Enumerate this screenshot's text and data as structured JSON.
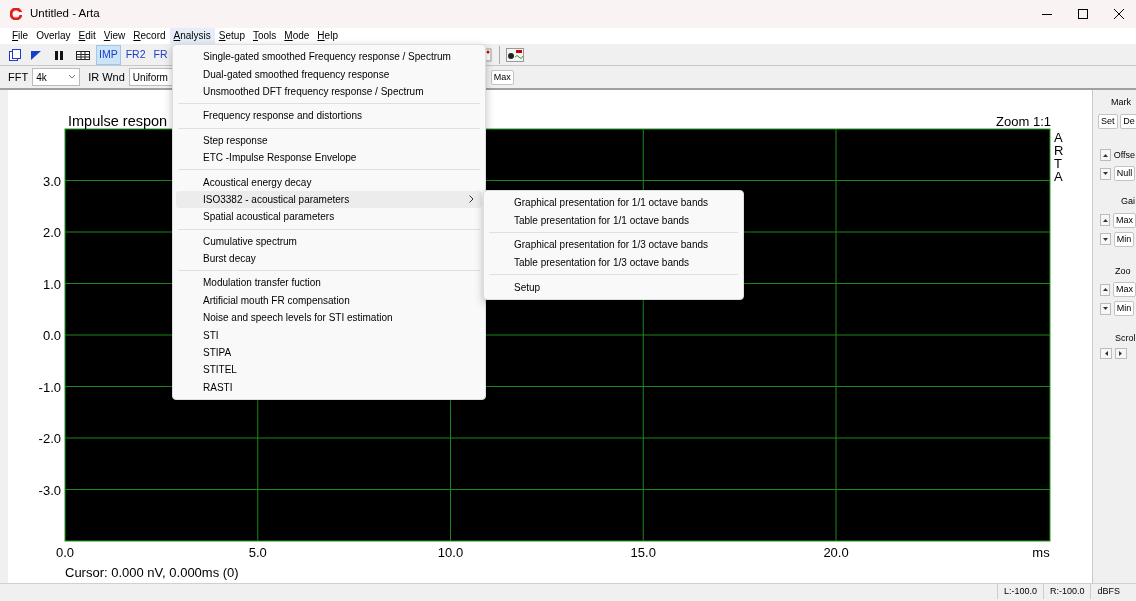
{
  "window": {
    "title": "Untitled - Arta"
  },
  "menubar": [
    {
      "label": "File",
      "mnemonic_underlined": true,
      "selected": false
    },
    {
      "label": "Overlay",
      "mnemonic_underlined": false,
      "selected": false
    },
    {
      "label": "Edit",
      "mnemonic_underlined": true,
      "selected": false
    },
    {
      "label": "View",
      "mnemonic_underlined": true,
      "selected": false
    },
    {
      "label": "Record",
      "mnemonic_underlined": true,
      "selected": false
    },
    {
      "label": "Analysis",
      "mnemonic_underlined": true,
      "selected": true
    },
    {
      "label": "Setup",
      "mnemonic_underlined": true,
      "selected": false
    },
    {
      "label": "Tools",
      "mnemonic_underlined": true,
      "selected": false
    },
    {
      "label": "Mode",
      "mnemonic_underlined": true,
      "selected": false
    },
    {
      "label": "Help",
      "mnemonic_underlined": true,
      "selected": false
    }
  ],
  "toolbar": {
    "view_buttons": [
      {
        "label": "IMP",
        "selected": true
      },
      {
        "label": "FR2",
        "selected": false
      },
      {
        "label": "FR",
        "selected": false
      }
    ]
  },
  "options_bar": {
    "fft_label": "FFT",
    "fft_value": "4k",
    "ir_window_label": "IR Wnd",
    "ir_window_value": "Uniform",
    "max_button": "Max"
  },
  "plot": {
    "title": "Impulse respon",
    "zoom": "Zoom 1:1",
    "brand_letters": [
      "A",
      "R",
      "T",
      "A"
    ],
    "cursor": "Cursor: 0.000 nV, 0.000ms (0)",
    "unit": "ms",
    "chart_data": {
      "type": "line",
      "grid": true,
      "xlim": [
        0,
        25.55
      ],
      "ylim": [
        -4,
        4
      ],
      "xticks": [
        {
          "value": 0,
          "label": "0.0"
        },
        {
          "value": 5,
          "label": "5.0"
        },
        {
          "value": 10,
          "label": "10.0"
        },
        {
          "value": 15,
          "label": "15.0"
        },
        {
          "value": 20,
          "label": "20.0"
        }
      ],
      "yticks": [
        {
          "value": 3,
          "label": "3.0"
        },
        {
          "value": 2,
          "label": "2.0"
        },
        {
          "value": 1,
          "label": "1.0"
        },
        {
          "value": 0,
          "label": "0.0"
        },
        {
          "value": -1,
          "label": "-1.0"
        },
        {
          "value": -2,
          "label": "-2.0"
        },
        {
          "value": -3,
          "label": "-3.0"
        }
      ]
    }
  },
  "side_panel": {
    "marker_label": "Mark",
    "set_button": "Set",
    "de_button": "De",
    "offset_label": "Offse",
    "null_button": "Null",
    "gain_label": "Gai",
    "gain_max": "Max",
    "gain_min": "Min",
    "zoom_label": "Zoo",
    "zoom_max": "Max",
    "zoom_min": "Min",
    "scroll_label": "Scrol"
  },
  "analysis_menu": {
    "groups": [
      [
        {
          "label": "Single-gated smoothed Frequency response / Spectrum",
          "selected": false,
          "submenu": false
        },
        {
          "label": "Dual-gated smoothed frequency response",
          "selected": false,
          "submenu": false
        },
        {
          "label": "Unsmoothed DFT frequency response / Spectrum",
          "selected": false,
          "submenu": false
        }
      ],
      [
        {
          "label": "Frequency response and distortions",
          "selected": false,
          "submenu": false
        }
      ],
      [
        {
          "label": "Step response",
          "selected": false,
          "submenu": false
        },
        {
          "label": "ETC -Impulse Response Envelope",
          "selected": false,
          "submenu": false
        }
      ],
      [
        {
          "label": "Acoustical energy decay",
          "selected": false,
          "submenu": false
        },
        {
          "label": "ISO3382 - acoustical parameters",
          "selected": true,
          "submenu": true
        },
        {
          "label": "Spatial acoustical parameters",
          "selected": false,
          "submenu": false
        }
      ],
      [
        {
          "label": "Cumulative spectrum",
          "selected": false,
          "submenu": false
        },
        {
          "label": "Burst decay",
          "selected": false,
          "submenu": false
        }
      ],
      [
        {
          "label": "Modulation transfer fuction",
          "selected": false,
          "submenu": false
        },
        {
          "label": "Artificial mouth FR compensation",
          "selected": false,
          "submenu": false
        },
        {
          "label": "Noise and speech levels for STI estimation",
          "selected": false,
          "submenu": false
        },
        {
          "label": "STI",
          "selected": false,
          "submenu": false
        },
        {
          "label": "STIPA",
          "selected": false,
          "submenu": false
        },
        {
          "label": "STITEL",
          "selected": false,
          "submenu": false
        },
        {
          "label": "RASTI",
          "selected": false,
          "submenu": false
        }
      ]
    ]
  },
  "iso_submenu": {
    "groups": [
      [
        {
          "label": "Graphical presentation for 1/1 octave bands",
          "selected": false
        },
        {
          "label": "Table presentation for 1/1 octave bands",
          "selected": false
        }
      ],
      [
        {
          "label": "Graphical presentation for 1/3 octave bands",
          "selected": false
        },
        {
          "label": "Table presentation for 1/3 octave bands",
          "selected": false
        }
      ],
      [
        {
          "label": "Setup",
          "selected": false
        }
      ]
    ]
  },
  "status_bar": {
    "left": "L:-100.0",
    "right": "R:-100.0",
    "unit": "dBFS"
  }
}
